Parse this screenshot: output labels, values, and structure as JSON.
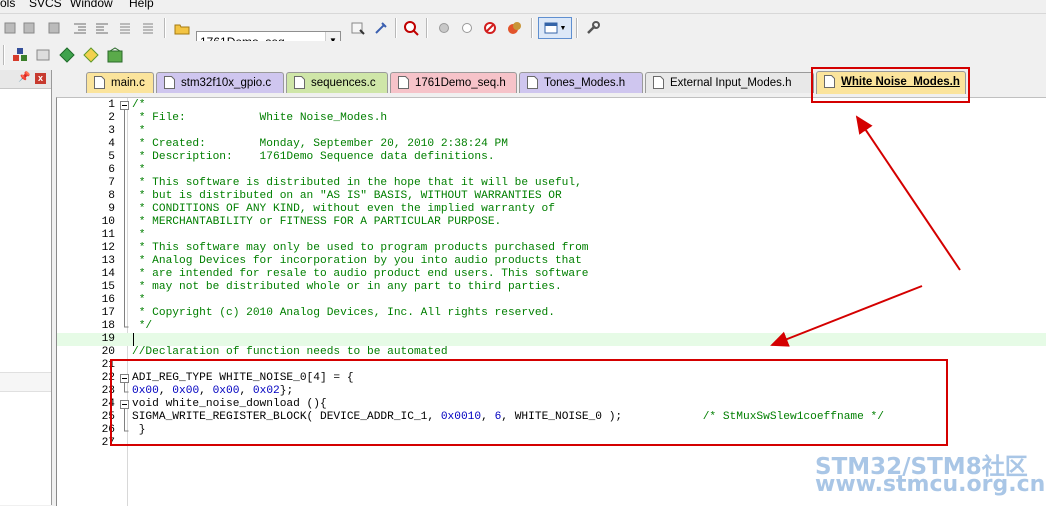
{
  "menu": {
    "items": [
      "ols",
      "SVCS",
      "Window",
      "Help"
    ]
  },
  "toolbar": {
    "target_combo_value": "1761Demo_seq"
  },
  "tabs": [
    {
      "label": "main.c",
      "color": "#fbe49c",
      "active": false
    },
    {
      "label": "stm32f10x_gpio.c",
      "color": "#cfc6ef",
      "active": false
    },
    {
      "label": "sequences.c",
      "color": "#cfe6a8",
      "active": false
    },
    {
      "label": "1761Demo_seq.h",
      "color": "#f6c3c9",
      "active": false
    },
    {
      "label": "Tones_Modes.h",
      "color": "#cfc6ef",
      "active": false
    },
    {
      "label": "External Input_Modes.h",
      "color": "#e8e8e8",
      "active": false
    },
    {
      "label": "White Noise_Modes.h",
      "color": "#fbe49c",
      "active": true
    }
  ],
  "editor": {
    "lines": [
      {
        "n": "1",
        "fold": "open",
        "segs": [
          {
            "t": "/*",
            "c": "cm"
          }
        ]
      },
      {
        "n": "2",
        "fold": "",
        "segs": [
          {
            "t": " * File:           White Noise_Modes.h",
            "c": "cm"
          }
        ]
      },
      {
        "n": "3",
        "fold": "",
        "segs": [
          {
            "t": " *",
            "c": "cm"
          }
        ]
      },
      {
        "n": "4",
        "fold": "",
        "segs": [
          {
            "t": " * Created:        Monday, September 20, 2010 2:38:24 PM",
            "c": "cm"
          }
        ]
      },
      {
        "n": "5",
        "fold": "",
        "segs": [
          {
            "t": " * Description:    1761Demo Sequence data definitions.",
            "c": "cm"
          }
        ]
      },
      {
        "n": "6",
        "fold": "",
        "segs": [
          {
            "t": " *",
            "c": "cm"
          }
        ]
      },
      {
        "n": "7",
        "fold": "",
        "segs": [
          {
            "t": " * This software is distributed in the hope that it will be useful,",
            "c": "cm"
          }
        ]
      },
      {
        "n": "8",
        "fold": "",
        "segs": [
          {
            "t": " * but is distributed on an \"AS IS\" BASIS, WITHOUT WARRANTIES OR",
            "c": "cm"
          }
        ]
      },
      {
        "n": "9",
        "fold": "",
        "segs": [
          {
            "t": " * CONDITIONS OF ANY KIND, without even the implied warranty of",
            "c": "cm"
          }
        ]
      },
      {
        "n": "10",
        "fold": "",
        "segs": [
          {
            "t": " * MERCHANTABILITY or FITNESS FOR A PARTICULAR PURPOSE.",
            "c": "cm"
          }
        ]
      },
      {
        "n": "11",
        "fold": "",
        "segs": [
          {
            "t": " *",
            "c": "cm"
          }
        ]
      },
      {
        "n": "12",
        "fold": "",
        "segs": [
          {
            "t": " * This software may only be used to program products purchased from",
            "c": "cm"
          }
        ]
      },
      {
        "n": "13",
        "fold": "",
        "segs": [
          {
            "t": " * Analog Devices for incorporation by you into audio products that",
            "c": "cm"
          }
        ]
      },
      {
        "n": "14",
        "fold": "",
        "segs": [
          {
            "t": " * are intended for resale to audio product end users. This software",
            "c": "cm"
          }
        ]
      },
      {
        "n": "15",
        "fold": "",
        "segs": [
          {
            "t": " * may not be distributed whole or in any part to third parties.",
            "c": "cm"
          }
        ]
      },
      {
        "n": "16",
        "fold": "",
        "segs": [
          {
            "t": " *",
            "c": "cm"
          }
        ]
      },
      {
        "n": "17",
        "fold": "",
        "segs": [
          {
            "t": " * Copyright (c) 2010 Analog Devices, Inc. All rights reserved.",
            "c": "cm"
          }
        ]
      },
      {
        "n": "18",
        "fold": "end",
        "segs": [
          {
            "t": " */",
            "c": "cm"
          }
        ]
      },
      {
        "n": "19",
        "fold": "",
        "hl": true,
        "segs": [
          {
            "t": "",
            "c": ""
          }
        ]
      },
      {
        "n": "20",
        "fold": "",
        "segs": [
          {
            "t": "//Declaration of function needs to be automated",
            "c": "cm"
          }
        ]
      },
      {
        "n": "21",
        "fold": "",
        "segs": [
          {
            "t": "",
            "c": ""
          }
        ]
      },
      {
        "n": "22",
        "fold": "open",
        "segs": [
          {
            "t": "ADI_REG_TYPE WHITE_NOISE_0[4] = {",
            "c": ""
          }
        ]
      },
      {
        "n": "23",
        "fold": "end",
        "segs": [
          {
            "t": "0x00",
            "c": "num"
          },
          {
            "t": ", ",
            "c": ""
          },
          {
            "t": "0x00",
            "c": "num"
          },
          {
            "t": ", ",
            "c": ""
          },
          {
            "t": "0x00",
            "c": "num"
          },
          {
            "t": ", ",
            "c": ""
          },
          {
            "t": "0x02",
            "c": "num"
          },
          {
            "t": "};",
            "c": ""
          }
        ]
      },
      {
        "n": "24",
        "fold": "open",
        "segs": [
          {
            "t": "void white_noise_download (){",
            "c": ""
          }
        ]
      },
      {
        "n": "25",
        "fold": "",
        "segs": [
          {
            "t": "SIGMA_WRITE_REGISTER_BLOCK( DEVICE_ADDR_IC_1, ",
            "c": ""
          },
          {
            "t": "0x0010",
            "c": "num"
          },
          {
            "t": ", ",
            "c": ""
          },
          {
            "t": "6",
            "c": "num"
          },
          {
            "t": ", WHITE_NOISE_0 );            ",
            "c": ""
          },
          {
            "t": "/* StMuxSwSlew1coeffname */",
            "c": "cm"
          }
        ]
      },
      {
        "n": "26",
        "fold": "end",
        "segs": [
          {
            "t": " }",
            "c": ""
          }
        ]
      },
      {
        "n": "27",
        "fold": "",
        "segs": [
          {
            "t": "",
            "c": ""
          }
        ]
      }
    ]
  },
  "watermark": {
    "line1": "STM32/STM8社区",
    "line2": "www.stmcu.org.cn"
  },
  "colors": {
    "annotation_red": "#d40000",
    "comment_green": "#007f00",
    "number_blue": "#0000c0"
  }
}
